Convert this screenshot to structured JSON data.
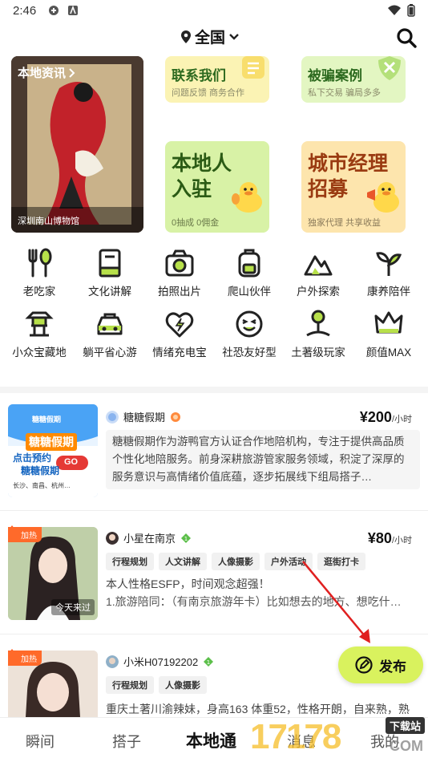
{
  "status": {
    "time": "2:46"
  },
  "header": {
    "location": "全国"
  },
  "hero": {
    "title": "本地资讯",
    "caption": "深圳南山博物馆"
  },
  "tiles": [
    {
      "title": "联系我们",
      "subtitle": "问题反馈 商务合作",
      "color": "#fbf3b4"
    },
    {
      "title": "被骗案例",
      "subtitle": "私下交易 骗局多多",
      "color": "#e3f6c2"
    },
    {
      "title_line1": "本地人",
      "title_line2": "入驻",
      "subtitle": "0抽成 0佣金",
      "color": "#d8f2a6"
    },
    {
      "title_line1": "城市经理",
      "title_line2": "招募",
      "subtitle": "独家代理 共享收益",
      "color": "#fde5ad"
    }
  ],
  "categories": [
    {
      "label": "老吃家",
      "icon": "fork-spoon-icon"
    },
    {
      "label": "文化讲解",
      "icon": "book-icon"
    },
    {
      "label": "拍照出片",
      "icon": "camera-icon"
    },
    {
      "label": "爬山伙伴",
      "icon": "backpack-icon"
    },
    {
      "label": "户外探索",
      "icon": "mountain-icon"
    },
    {
      "label": "康养陪伴",
      "icon": "sprout-icon"
    },
    {
      "label": "小众宝藏地",
      "icon": "pagoda-icon"
    },
    {
      "label": "躺平省心游",
      "icon": "car-icon"
    },
    {
      "label": "情绪充电宝",
      "icon": "heart-bolt-icon"
    },
    {
      "label": "社恐友好型",
      "icon": "face-icon"
    },
    {
      "label": "土著级玩家",
      "icon": "map-pin-icon"
    },
    {
      "label": "颜值MAX",
      "icon": "crown-icon"
    }
  ],
  "listings": [
    {
      "author": "糖糖假期",
      "price": "¥200",
      "unit": "/小时",
      "description": "糖糖假期作为游鸭官方认证合作地陪机构，专注于提供高品质个性化地陪服务。前身深耕旅游管家服务领域，积淀了深厚的服务意识与高情绪价值底蕴，逐步拓展线下组局搭子…",
      "thumb_text_1": "糖糖假期",
      "thumb_text_2": "点击预约",
      "thumb_text_3": "糖糖假期",
      "thumb_text_4": "长沙、南昌、杭州…",
      "thumb_go": "GO"
    },
    {
      "author": "小星在南京",
      "price": "¥80",
      "unit": "/小时",
      "badge": "加热",
      "tags": [
        "行程规划",
        "人文讲解",
        "人像摄影",
        "户外活动",
        "逛街打卡"
      ],
      "description_line1": "本人性格ESFP，时间观念超强！",
      "description_line2": "1.旅游陪同：（有南京旅游年卡）比如想去的地方、想吃什…",
      "thumb_caption": "今天来过"
    },
    {
      "author": "小米H07192202",
      "badge": "加热",
      "tags": [
        "行程规划",
        "人像摄影"
      ],
      "description_line1": "重庆土著川渝辣妹，身高163 体重52，性格开朗，自来熟，熟"
    }
  ],
  "fab": {
    "label": "发布"
  },
  "nav": [
    "瞬间",
    "搭子",
    "本地通",
    "消息",
    "我的"
  ],
  "watermark": {
    "text": "17178",
    "tag": "下载站",
    "domain": "COM"
  }
}
